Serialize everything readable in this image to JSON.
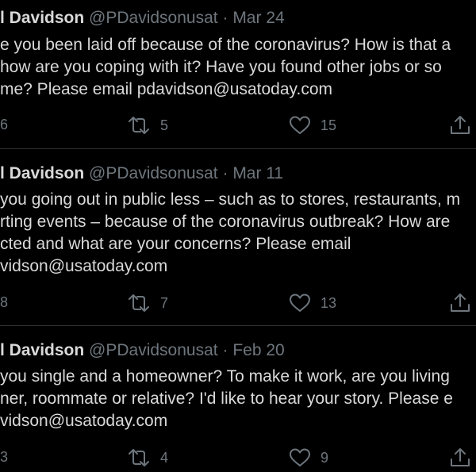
{
  "tweets": [
    {
      "name": "l Davidson",
      "handle": "@PDavidsonusat",
      "separator": "·",
      "date": "Mar 24",
      "lines": [
        "e you been laid off because of the coronavirus? How is that a",
        "how are you coping with it? Have you found other jobs or so",
        "me? Please email pdavidson@usatoday.com"
      ],
      "reply_count": "6",
      "retweet_count": "5",
      "like_count": "15"
    },
    {
      "name": "l Davidson",
      "handle": "@PDavidsonusat",
      "separator": "·",
      "date": "Mar 11",
      "lines": [
        "you going out in public less – such as to stores, restaurants, m",
        "rting events – because of the coronavirus outbreak? How are",
        "cted and what are your concerns? Please email",
        "vidson@usatoday.com"
      ],
      "reply_count": "8",
      "retweet_count": "7",
      "like_count": "13"
    },
    {
      "name": "l Davidson",
      "handle": "@PDavidsonusat",
      "separator": "·",
      "date": "Feb 20",
      "lines": [
        "you single and a homeowner? To make it work, are you living",
        "ner, roommate or relative? I'd like to hear your story. Please e",
        "vidson@usatoday.com"
      ],
      "reply_count": "3",
      "retweet_count": "4",
      "like_count": "9"
    }
  ],
  "icons": {
    "retweet": "retweet-icon",
    "like": "heart-icon",
    "share": "share-icon"
  },
  "colors": {
    "background": "#000000",
    "text": "#d9d9d9",
    "secondary": "#6e767d",
    "divider": "#2f3336"
  }
}
